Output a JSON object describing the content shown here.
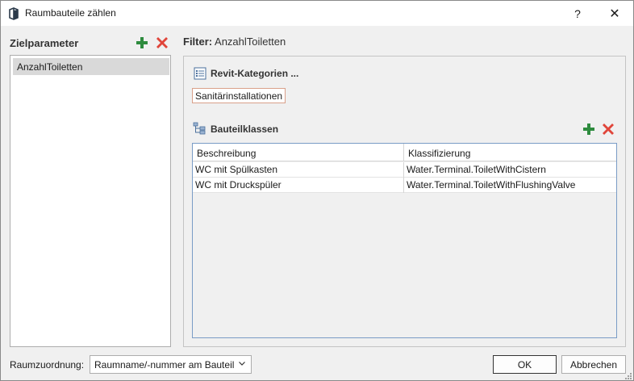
{
  "window": {
    "title": "Raumbauteile zählen",
    "help_label": "?",
    "close_label": "✕"
  },
  "left": {
    "heading": "Zielparameter",
    "items": [
      {
        "label": "AnzahlToiletten",
        "selected": true
      }
    ]
  },
  "filter": {
    "heading_label": "Filter:",
    "heading_value": "AnzahlToiletten"
  },
  "categories": {
    "heading": "Revit-Kategorien ...",
    "items": [
      "Sanitärinstallationen"
    ]
  },
  "classes": {
    "heading": "Bauteilklassen",
    "columns": [
      "Beschreibung",
      "Klassifizierung"
    ],
    "rows": [
      [
        "WC mit Spülkasten",
        "Water.Terminal.ToiletWithCistern"
      ],
      [
        "WC mit Druckspüler",
        "Water.Terminal.ToiletWithFlushingValve"
      ]
    ]
  },
  "footer": {
    "assignment_label": "Raumzuordnung:",
    "assignment_value": "Raumname/-nummer am Bauteil",
    "ok_label": "OK",
    "cancel_label": "Abbrechen"
  },
  "colors": {
    "add_green": "#2e8b3e",
    "delete_red": "#e0453a",
    "grid_border": "#7a9cc6",
    "chip_border": "#d9a08a"
  },
  "icons": [
    "app-icon",
    "add-icon",
    "delete-icon",
    "list-icon",
    "tree-icon",
    "chevron-down-icon",
    "help-icon",
    "close-icon",
    "resize-grip-icon"
  ]
}
